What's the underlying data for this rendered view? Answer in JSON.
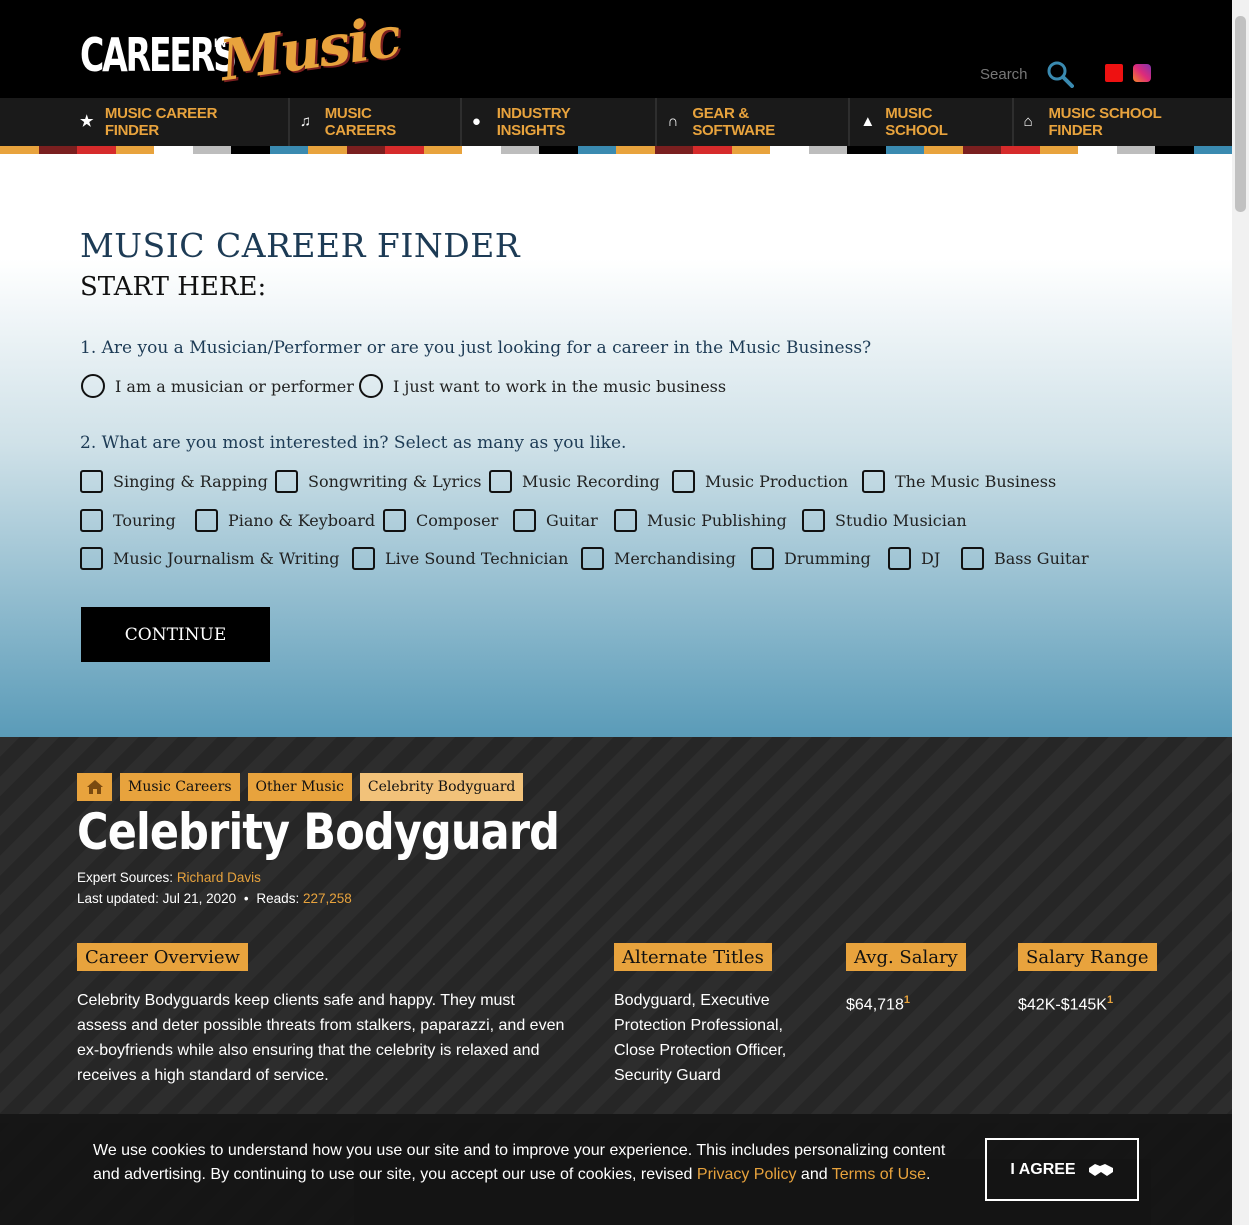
{
  "header": {
    "logo": {
      "careers": "CAREERS",
      "in": "IN",
      "music": "Music"
    },
    "search_placeholder": "Search"
  },
  "nav": {
    "items": [
      {
        "label": "MUSIC CAREER FINDER",
        "icon": "star-icon"
      },
      {
        "label": "MUSIC CAREERS",
        "icon": "music-note-icon"
      },
      {
        "label": "INDUSTRY INSIGHTS",
        "icon": "chat-bubbles-icon"
      },
      {
        "label": "GEAR & SOFTWARE",
        "icon": "headphones-icon"
      },
      {
        "label": "MUSIC SCHOOL",
        "icon": "graduation-cap-icon"
      },
      {
        "label": "MUSIC SCHOOL FINDER",
        "icon": "institution-icon"
      }
    ],
    "stripe_colors": [
      "#e8a33d",
      "#7a1f1f",
      "#d62b2b",
      "#e8a33d",
      "#ffffff",
      "#bdbdbd",
      "#000000",
      "#3a8ab0"
    ]
  },
  "finder": {
    "title": "MUSIC CAREER FINDER",
    "subtitle": "START HERE:",
    "q1": "1. Are you a Musician/Performer or are you just looking for a career in the Music Business?",
    "q1_options": [
      "I am a musician or performer",
      "I just want to work in the music business"
    ],
    "q2": "2. What are you most interested in? Select as many as you like.",
    "interests_row1": [
      "Singing & Rapping",
      "Songwriting & Lyrics",
      "Music Recording",
      "Music Production",
      "The Music Business"
    ],
    "interests_row2": [
      "Touring",
      "Piano & Keyboard",
      "Composer",
      "Guitar",
      "Music Publishing",
      "Studio Musician"
    ],
    "interests_row3": [
      "Music Journalism & Writing",
      "Live Sound Technician",
      "Merchandising",
      "Drumming",
      "DJ",
      "Bass Guitar"
    ],
    "continue_label": "CONTINUE"
  },
  "career": {
    "breadcrumbs": [
      "Music Careers",
      "Other Music",
      "Celebrity Bodyguard"
    ],
    "title": "Celebrity Bodyguard",
    "expert_label": "Expert Sources:",
    "expert_name": "Richard Davis",
    "updated_label": "Last updated:",
    "updated_date": "Jul 21, 2020",
    "sep": "•",
    "reads_label": "Reads:",
    "reads_count": "227,258",
    "overview_tag": "Career Overview",
    "overview_text": "Celebrity Bodyguards keep clients safe and happy. They must assess and deter possible threats from stalkers, paparazzi, and even ex-boyfriends while also ensuring that the celebrity is relaxed and receives a high standard of service.",
    "alt_tag": "Alternate Titles",
    "alt_text": "Bodyguard, Executive Protection Professional, Close Protection Officer, Security Guard",
    "salary_tag": "Avg. Salary",
    "salary_value": "$64,718",
    "range_tag": "Salary Range",
    "range_value": "$42K-$145K",
    "footnote": "1"
  },
  "cookie": {
    "text_1": "We use cookies to understand how you use our site and to improve your experience. This includes personalizing content and advertising. By continuing to use our site, you accept our use of cookies, revised ",
    "privacy_link": "Privacy Policy",
    "and": " and ",
    "terms_link": "Terms of Use",
    "period": ".",
    "agree_label": "I AGREE"
  }
}
